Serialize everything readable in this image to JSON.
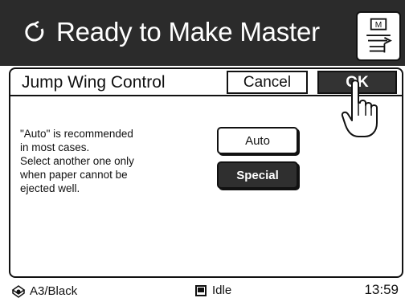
{
  "header": {
    "title": "Ready to Make Master",
    "busy_icon": "circular-arrow-icon",
    "master_button_icon": "master-document-icon",
    "master_label": "M"
  },
  "dialog": {
    "title": "Jump Wing Control",
    "cancel_label": "Cancel",
    "ok_label": "OK",
    "message_lines": [
      "\"Auto\" is recommended",
      "in most cases.",
      "Select another one only",
      "when paper cannot be",
      "ejected well."
    ],
    "options": [
      {
        "label": "Auto",
        "selected": false
      },
      {
        "label": "Special",
        "selected": true
      }
    ]
  },
  "status": {
    "paper_icon": "paper-tray-icon",
    "paper": "A3/Black",
    "state_icon": "idle-square-icon",
    "state": "Idle",
    "time": "13:59"
  },
  "colors": {
    "header_bg": "#2b2b2b",
    "selected_bg": "#2f2f2f",
    "border": "#111111"
  }
}
